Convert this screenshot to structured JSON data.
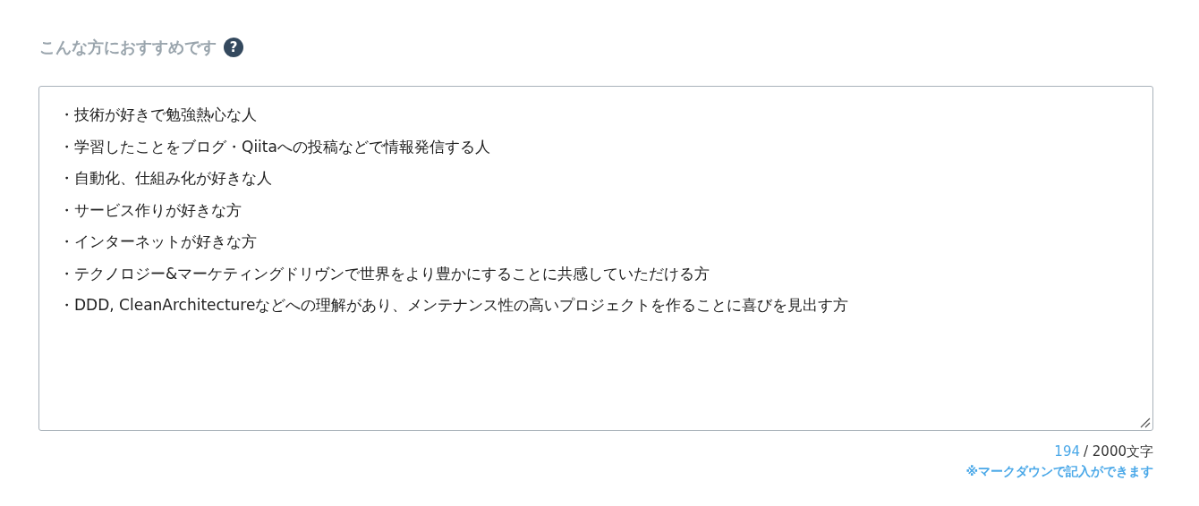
{
  "label": "こんな方におすすめです",
  "help_icon": "?",
  "textarea": {
    "lines": [
      "・技術が好きで勉強熱心な人",
      "・学習したことをブログ・Qiitaへの投稿などで情報発信する人",
      "・自動化、仕組み化が好きな人",
      "・サービス作りが好きな方",
      "・インターネットが好きな方",
      "・テクノロジー&マーケティングドリヴンで世界をより豊かにすることに共感していただける方",
      "・DDD, CleanArchitectureなどへの理解があり、メンテナンス性の高いプロジェクトを作ることに喜びを見出す方"
    ]
  },
  "counter": {
    "count": "194",
    "limit": "/ 2000文字"
  },
  "note": "※マークダウンで記入ができます"
}
